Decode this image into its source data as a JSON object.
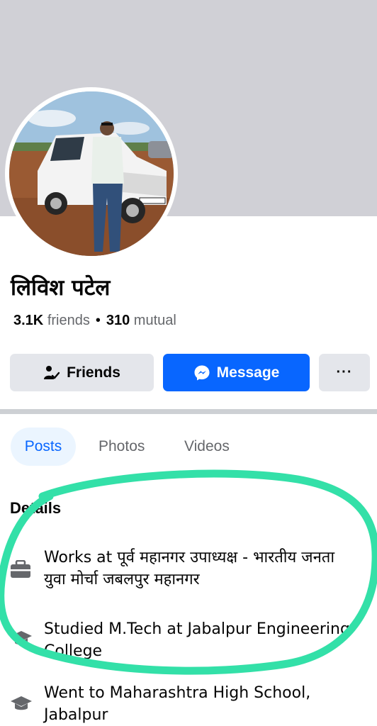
{
  "profile": {
    "name": "लिविश पटेल",
    "friends_count": "3.1K",
    "friends_label": "friends",
    "separator": "•",
    "mutual_count": "310",
    "mutual_label": "mutual"
  },
  "actions": {
    "friends_label": "Friends",
    "message_label": "Message",
    "more_label": "···"
  },
  "tabs": [
    {
      "label": "Posts",
      "active": true
    },
    {
      "label": "Photos",
      "active": false
    },
    {
      "label": "Videos",
      "active": false
    }
  ],
  "details": {
    "title": "Details",
    "items": [
      {
        "icon": "briefcase-icon",
        "text": "Works at पूर्व महानगर उपाध्यक्ष - भारतीय जनता युवा मोर्चा जबलपुर महानगर"
      },
      {
        "icon": "graduation-cap-icon",
        "text": "Studied M.Tech at Jabalpur Engineering College"
      },
      {
        "icon": "graduation-cap-icon",
        "text": "Went to Maharashtra High School, Jabalpur"
      }
    ]
  },
  "colors": {
    "accent": "#0866ff",
    "annotation": "#33e0a8",
    "cover": "#d0d0d6"
  }
}
